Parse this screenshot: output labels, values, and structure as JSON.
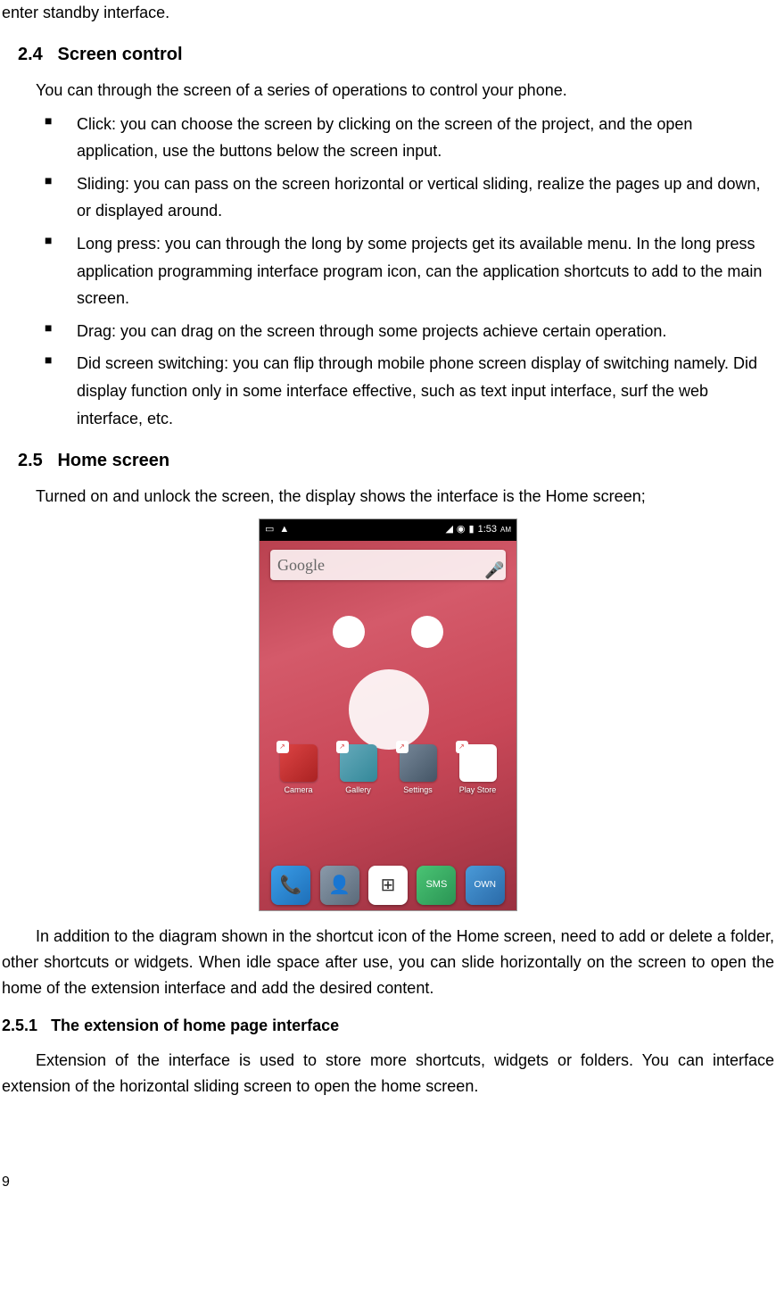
{
  "top_fragment": "enter standby interface.",
  "section24": {
    "number": "2.4",
    "title": "Screen control",
    "intro": "You can through the screen of a series of operations to control your phone.",
    "bullets": [
      "Click: you can choose the screen by clicking on the screen of the project, and the open application, use the buttons below the screen input.",
      "Sliding: you can pass on the screen horizontal or vertical sliding, realize the pages up and down, or displayed around.",
      "Long press: you can through the long by some projects get its available menu. In the long press application programming interface program icon, can the application shortcuts to add to the main screen.",
      "Drag: you can drag on the screen through some projects achieve certain operation.",
      "Did screen switching: you can flip through mobile phone screen display of switching namely. Did display function only in some interface effective, such as text input interface, surf the web interface, etc."
    ]
  },
  "section25": {
    "number": "2.5",
    "title": "Home screen",
    "intro": "Turned on and unlock the screen, the display shows the interface is the Home screen;",
    "after_image": "In addition to the diagram shown in the shortcut icon of the Home screen, need to add or delete a folder, other shortcuts or widgets. When idle space after use, you can slide horizontally on the screen to open the home of the extension interface and add the desired content."
  },
  "section251": {
    "number": "2.5.1",
    "title": "The extension of home page interface",
    "body": "Extension of the interface is used to store more shortcuts, widgets or folders. You can interface extension of the horizontal sliding screen to open the home screen."
  },
  "phone": {
    "time": "1:53",
    "ampm": "AM",
    "search_brand": "Google",
    "apps": {
      "camera": "Camera",
      "gallery": "Gallery",
      "settings": "Settings",
      "playstore": "Play Store"
    },
    "dock": {
      "sms": "SMS",
      "own": "OWN"
    }
  },
  "page_number": "9"
}
